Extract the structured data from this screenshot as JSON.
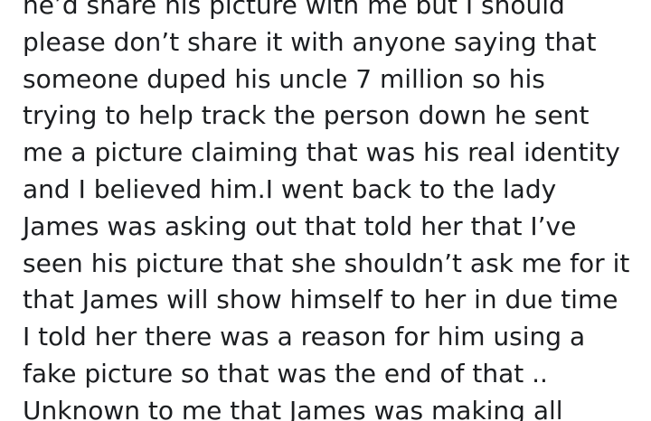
{
  "post": {
    "lines": [
      "he’d share his picture with me but I should",
      "please don’t share it with anyone saying that",
      "someone duped his uncle 7 million so his",
      "trying to help track the person down he sent",
      "me a picture claiming that was his real identity",
      "and I believed him.I went back to the lady",
      "James was asking out that told her that I’ve",
      "seen his picture that she shouldn’t ask me for it",
      "that James will show himself to her in due time",
      "I told her there was a reason for him using a",
      "fake picture so that was the end of that ..",
      "Unknown to me that James was making all"
    ]
  }
}
